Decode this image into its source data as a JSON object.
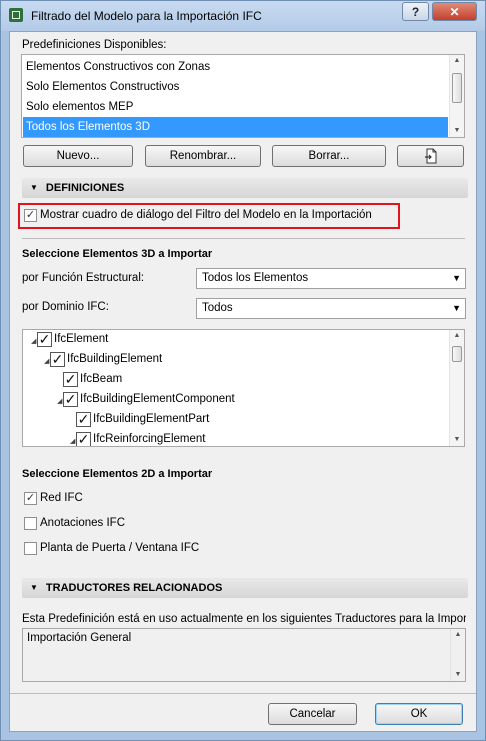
{
  "window": {
    "title": "Filtrado del Modelo para la Importación IFC",
    "help_label": "?",
    "close_label": "✕"
  },
  "presets": {
    "label": "Predefiniciones Disponibles:",
    "items": [
      "Elementos Constructivos con Zonas",
      "Solo Elementos Constructivos",
      "Solo elementos MEP",
      "Todos los Elementos 3D"
    ],
    "selected": "Todos los Elementos 3D",
    "new_label": "Nuevo...",
    "rename_label": "Renombrar...",
    "delete_label": "Borrar...",
    "export_icon": "export-document-icon"
  },
  "definitions": {
    "header": "DEFINICIONES",
    "show_dialog_label": "Mostrar cuadro de diálogo del Filtro del Modelo en la Importación",
    "show_dialog_checked": true
  },
  "elements3d": {
    "header": "Seleccione Elementos 3D a Importar",
    "structural_label": "por Función Estructural:",
    "structural_value": "Todos los Elementos",
    "domain_label": "por Dominio IFC:",
    "domain_value": "Todos",
    "tree": [
      {
        "label": "IfcElement",
        "checked": true,
        "expandable": true
      },
      {
        "label": "IfcBuildingElement",
        "checked": true,
        "expandable": true
      },
      {
        "label": "IfcBeam",
        "checked": true,
        "expandable": false
      },
      {
        "label": "IfcBuildingElementComponent",
        "checked": true,
        "expandable": true
      },
      {
        "label": "IfcBuildingElementPart",
        "checked": true,
        "expandable": false
      },
      {
        "label": "IfcReinforcingElement",
        "checked": true,
        "expandable": true
      }
    ]
  },
  "elements2d": {
    "header": "Seleccione Elementos 2D a Importar",
    "items": [
      {
        "label": "Red IFC",
        "checked": true
      },
      {
        "label": "Anotaciones IFC",
        "checked": false
      },
      {
        "label": "Planta de Puerta / Ventana IFC",
        "checked": false
      }
    ]
  },
  "translators": {
    "header": "TRADUCTORES RELACIONADOS",
    "description": "Esta Predefinición está en uso actualmente en los siguientes Traductores para la Impor",
    "items": [
      "Importación General"
    ]
  },
  "footer": {
    "cancel_label": "Cancelar",
    "ok_label": "OK"
  }
}
